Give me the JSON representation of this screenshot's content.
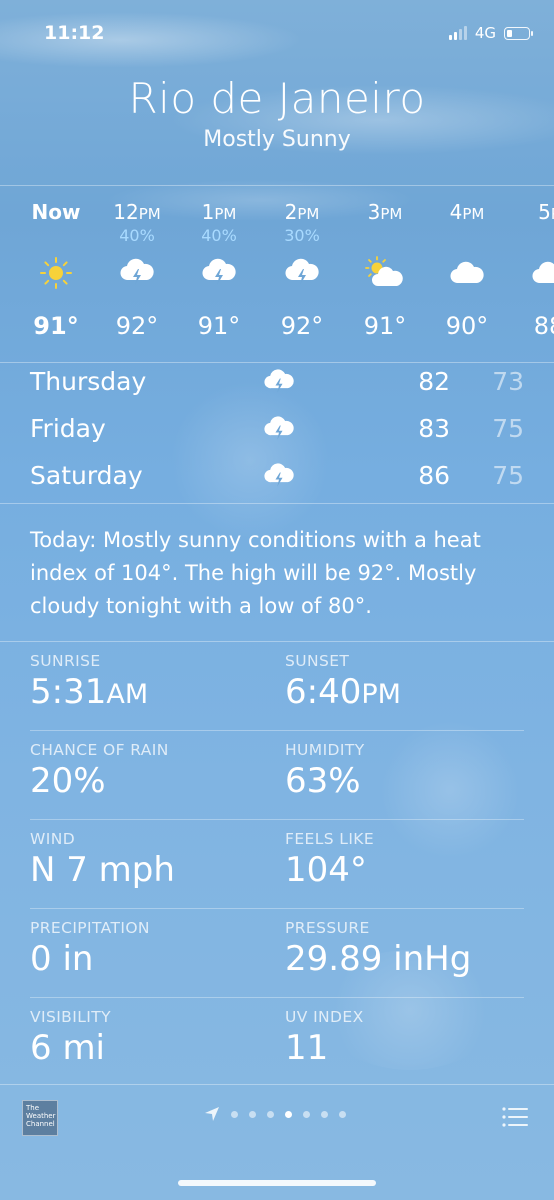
{
  "status_bar": {
    "time": "11:12",
    "network": "4G"
  },
  "header": {
    "city": "Rio de Janeiro",
    "condition": "Mostly Sunny"
  },
  "hourly": [
    {
      "label": "Now",
      "suffix": "",
      "precip": "",
      "icon": "sun-icon",
      "temp": "91°"
    },
    {
      "label": "12",
      "suffix": "PM",
      "precip": "40%",
      "icon": "thunderstorm-icon",
      "temp": "92°"
    },
    {
      "label": "1",
      "suffix": "PM",
      "precip": "40%",
      "icon": "thunderstorm-icon",
      "temp": "91°"
    },
    {
      "label": "2",
      "suffix": "PM",
      "precip": "30%",
      "icon": "thunderstorm-icon",
      "temp": "92°"
    },
    {
      "label": "3",
      "suffix": "PM",
      "precip": "",
      "icon": "partly-sunny-icon",
      "temp": "91°"
    },
    {
      "label": "4",
      "suffix": "PM",
      "precip": "",
      "icon": "cloud-icon",
      "temp": "90°"
    },
    {
      "label": "5",
      "suffix": "P",
      "precip": "",
      "icon": "cloud-icon",
      "temp": "88"
    }
  ],
  "daily": [
    {
      "day": "Thursday",
      "icon": "thunderstorm-icon",
      "high": "82",
      "low": "73"
    },
    {
      "day": "Friday",
      "icon": "thunderstorm-icon",
      "high": "83",
      "low": "75"
    },
    {
      "day": "Saturday",
      "icon": "thunderstorm-icon",
      "high": "86",
      "low": "75"
    }
  ],
  "summary": "Today: Mostly sunny conditions with a heat index of 104°. The high will be 92°. Mostly cloudy tonight with a low of 80°.",
  "details": [
    {
      "left": {
        "label": "SUNRISE",
        "value": "5:31",
        "suffix": "AM"
      },
      "right": {
        "label": "SUNSET",
        "value": "6:40",
        "suffix": "PM"
      }
    },
    {
      "left": {
        "label": "CHANCE OF RAIN",
        "value": "20%",
        "suffix": ""
      },
      "right": {
        "label": "HUMIDITY",
        "value": "63%",
        "suffix": ""
      }
    },
    {
      "left": {
        "label": "WIND",
        "value": "N 7 mph",
        "suffix": ""
      },
      "right": {
        "label": "FEELS LIKE",
        "value": "104°",
        "suffix": ""
      }
    },
    {
      "left": {
        "label": "PRECIPITATION",
        "value": "0 in",
        "suffix": ""
      },
      "right": {
        "label": "PRESSURE",
        "value": "29.89 inHg",
        "suffix": ""
      }
    },
    {
      "left": {
        "label": "VISIBILITY",
        "value": "6 mi",
        "suffix": ""
      },
      "right": {
        "label": "UV INDEX",
        "value": "11",
        "suffix": ""
      }
    }
  ],
  "bottom_bar": {
    "logo_text": "The Weather Channel",
    "page_count": 7,
    "active_page": 3
  },
  "colors": {
    "sun": "#f7d23a",
    "precip": "#a9daff"
  }
}
